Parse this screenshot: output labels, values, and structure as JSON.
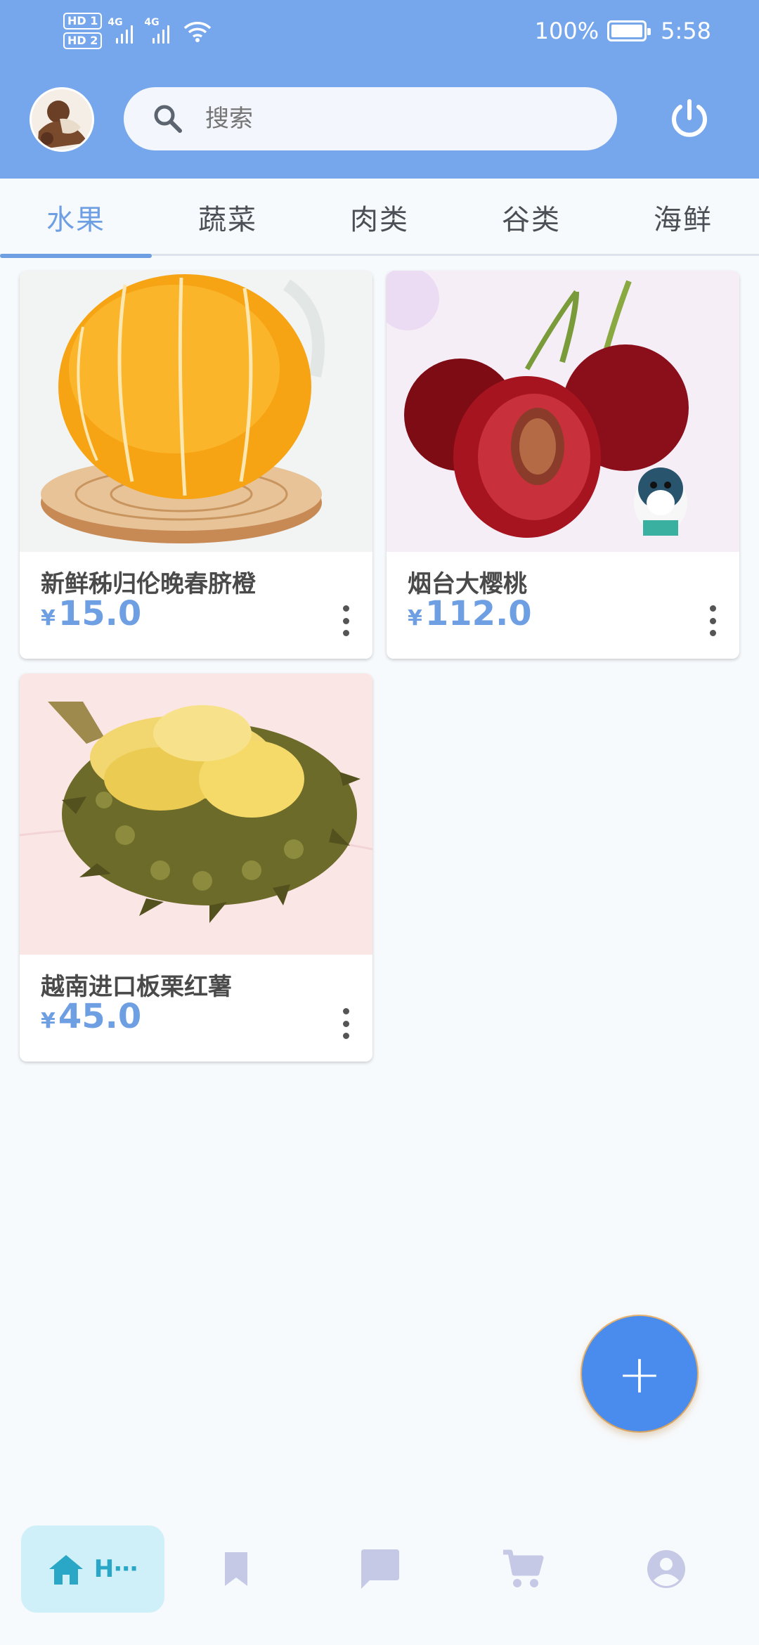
{
  "status_bar": {
    "sim1": "HD 1",
    "sim2": "HD 2",
    "net1": "4G",
    "net2": "4G",
    "battery": "100%",
    "time": "5:58"
  },
  "header": {
    "search_placeholder": "搜索"
  },
  "tabs": [
    {
      "label": "水果",
      "active": true
    },
    {
      "label": "蔬菜",
      "active": false
    },
    {
      "label": "肉类",
      "active": false
    },
    {
      "label": "谷类",
      "active": false
    },
    {
      "label": "海鲜",
      "active": false
    }
  ],
  "products": [
    {
      "name": "新鲜秭归伦晚春脐橙",
      "currency": "¥",
      "price": "15.0"
    },
    {
      "name": "烟台大樱桃",
      "currency": "¥",
      "price": "112.0"
    },
    {
      "name": "越南进口板栗红薯",
      "currency": "¥",
      "price": "45.0"
    }
  ],
  "fab": {
    "label": "+"
  },
  "bottom_nav": {
    "items": [
      {
        "icon": "home-icon",
        "label": "H⋯",
        "active": true
      },
      {
        "icon": "bookmark-icon",
        "active": false
      },
      {
        "icon": "chat-icon",
        "active": false
      },
      {
        "icon": "cart-icon",
        "active": false
      },
      {
        "icon": "account-icon",
        "active": false
      }
    ]
  },
  "colors": {
    "header": "#76A7EC",
    "accent": "#6F9FE3",
    "fab": "#4A8BEE",
    "nav_active_bg": "#CFF0F8",
    "nav_active_fg": "#2AA7C6",
    "nav_inactive": "#C6C9E6"
  }
}
